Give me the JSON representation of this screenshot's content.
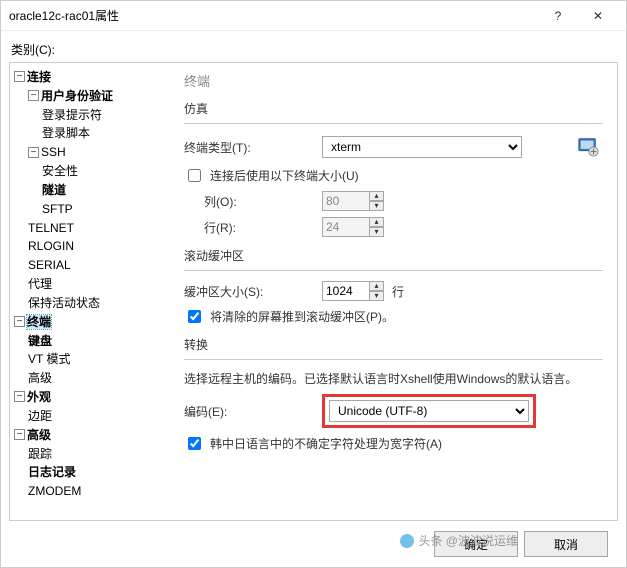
{
  "title": "oracle12c-rac01属性",
  "category_label": "类别(C):",
  "tree": {
    "n0": "连接",
    "n0_0": "用户身份验证",
    "n0_0_0": "登录提示符",
    "n0_0_1": "登录脚本",
    "n0_1": "SSH",
    "n0_1_0": "安全性",
    "n0_1_1": "隧道",
    "n0_1_2": "SFTP",
    "n0_2": "TELNET",
    "n0_3": "RLOGIN",
    "n0_4": "SERIAL",
    "n0_5": "代理",
    "n0_6": "保持活动状态",
    "n1": "终端",
    "n1_0": "键盘",
    "n1_1": "VT 模式",
    "n1_2": "高级",
    "n2": "外观",
    "n2_0": "边距",
    "n3": "高级",
    "n3_0": "跟踪",
    "n3_1": "日志记录",
    "n3_2": "ZMODEM"
  },
  "content": {
    "heading": "终端",
    "emulation_title": "仿真",
    "terminal_type_label": "终端类型(T):",
    "terminal_type_value": "xterm",
    "use_size_label": "连接后使用以下终端大小(U)",
    "cols_label": "列(O):",
    "cols_value": "80",
    "rows_label": "行(R):",
    "rows_value": "24",
    "scroll_title": "滚动缓冲区",
    "buffer_label": "缓冲区大小(S):",
    "buffer_value": "1024",
    "buffer_unit": "行",
    "push_cleared_label": "将清除的屏幕推到滚动缓冲区(P)。",
    "translate_title": "转换",
    "translate_desc": "选择远程主机的编码。已选择默认语言时Xshell使用Windows的默认语言。",
    "encoding_label": "编码(E):",
    "encoding_value": "Unicode (UTF-8)",
    "cjk_label": "韩中日语言中的不确定字符处理为宽字符(A)"
  },
  "buttons": {
    "ok": "确定",
    "cancel": "取消"
  },
  "watermark": "头条 @波波说运维"
}
